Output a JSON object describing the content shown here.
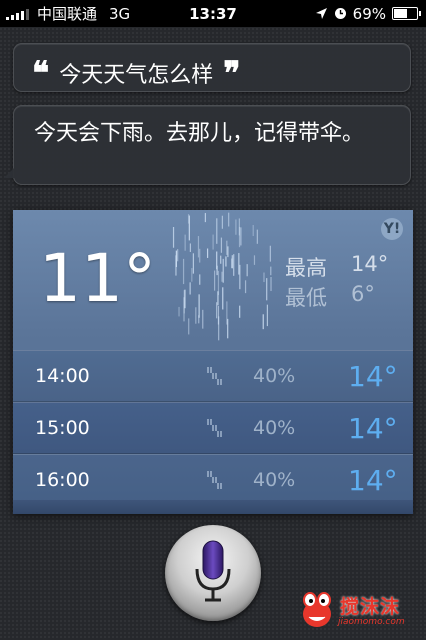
{
  "status_bar": {
    "carrier": "中国联通",
    "network": "3G",
    "time": "13:37",
    "battery_percent": "69%",
    "battery_level": 0.69
  },
  "query": {
    "open_quote": "❝",
    "text": "今天天气怎么样",
    "close_quote": "❞"
  },
  "answer": {
    "text": "今天会下雨。去那儿，记得带伞。"
  },
  "weather": {
    "current_temp": "11°",
    "high_label": "最高",
    "high_value": "14°",
    "low_label": "最低",
    "low_value": "6°",
    "provider_logo": "Y!",
    "hourly": [
      {
        "time": "14:00",
        "precip": "40%",
        "temp": "14°"
      },
      {
        "time": "15:00",
        "precip": "40%",
        "temp": "14°"
      },
      {
        "time": "16:00",
        "precip": "40%",
        "temp": "14°"
      }
    ]
  },
  "mic": {
    "icon": "microphone-icon"
  },
  "watermark": {
    "brand": "搅沫沫",
    "url": "jiaomomo.com"
  },
  "colors": {
    "status_bar": "#000000",
    "background": "#26282c",
    "card_top": "#6d89ad",
    "hour_temp": "#5eaef0",
    "mic_purple": "#4a2a8c"
  }
}
